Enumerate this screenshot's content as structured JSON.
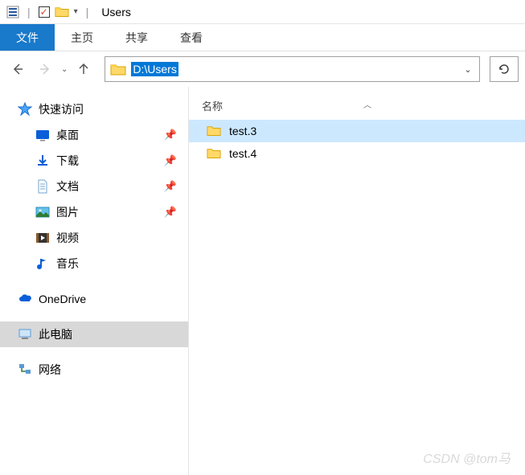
{
  "titlebar": {
    "title": "Users"
  },
  "ribbon": {
    "file": "文件",
    "home": "主页",
    "share": "共享",
    "view": "查看"
  },
  "address": {
    "path": "D:\\Users"
  },
  "sidebar": {
    "quick_access": "快速访问",
    "items": [
      {
        "label": "桌面",
        "pinned": true
      },
      {
        "label": "下载",
        "pinned": true
      },
      {
        "label": "文档",
        "pinned": true
      },
      {
        "label": "图片",
        "pinned": true
      },
      {
        "label": "视频",
        "pinned": false
      },
      {
        "label": "音乐",
        "pinned": false
      }
    ],
    "onedrive": "OneDrive",
    "this_pc": "此电脑",
    "network": "网络"
  },
  "content": {
    "header_name": "名称",
    "rows": [
      {
        "name": "test.3"
      },
      {
        "name": "test.4"
      }
    ]
  },
  "watermark": "CSDN @tom马"
}
